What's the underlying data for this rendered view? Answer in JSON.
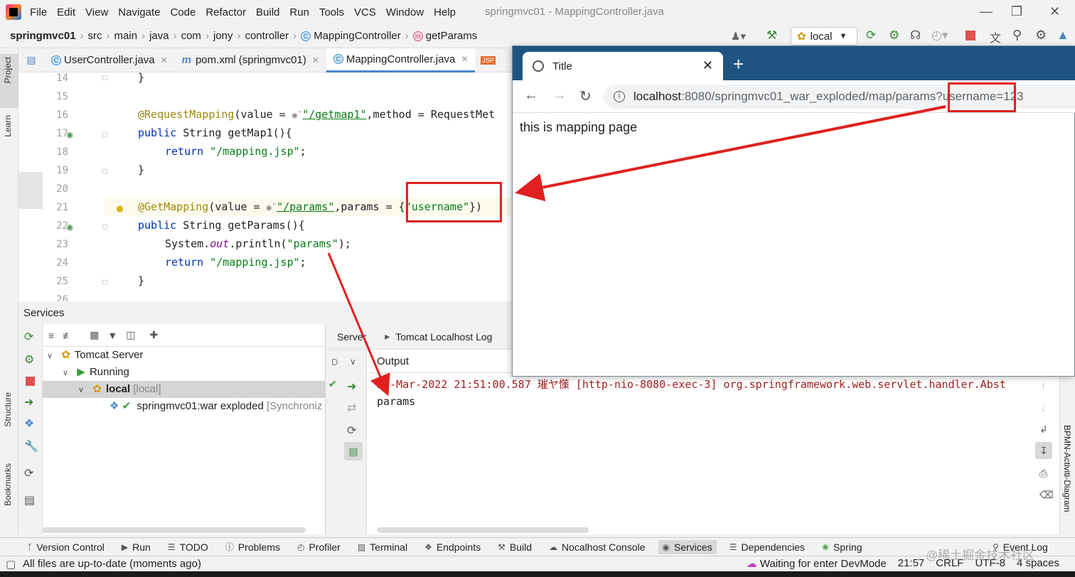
{
  "menubar": {
    "items": [
      "File",
      "Edit",
      "View",
      "Navigate",
      "Code",
      "Refactor",
      "Build",
      "Run",
      "Tools",
      "VCS",
      "Window",
      "Help"
    ],
    "window_title": "springmvc01 - MappingController.java"
  },
  "breadcrumb": {
    "project": "springmvc01",
    "parts": [
      "src",
      "main",
      "java",
      "com",
      "jony",
      "controller"
    ],
    "class": "MappingController",
    "method": "getParams"
  },
  "toolbar": {
    "run_config": "local"
  },
  "left_strip": {
    "project": "Project",
    "learn": "Learn",
    "structure": "Structure",
    "bookmarks": "Bookmarks"
  },
  "tabs": [
    {
      "label": "UserController.java"
    },
    {
      "label": "pom.xml (springmvc01)"
    },
    {
      "label": "MappingController.java"
    }
  ],
  "editor": {
    "line_numbers": [
      "14",
      "15",
      "16",
      "17",
      "18",
      "19",
      "20",
      "21",
      "22",
      "23",
      "24",
      "25",
      "26"
    ],
    "l14": "}",
    "l16_ann": "@RequestMapping",
    "l16_a": "(value = ",
    "l16_str": "\"/getmap1\"",
    "l16_b": ",method = RequestMet",
    "l17_kw": "public",
    "l17_rest": " String getMap1(){",
    "l18_kw": "return",
    "l18_str": " \"/mapping.jsp\"",
    "l18_end": ";",
    "l19": "}",
    "l21_ann": "@GetMapping",
    "l21_a": "(value = ",
    "l21_str": "\"/params\"",
    "l21_b": ",params = {",
    "l21_str2": "\"username\"",
    "l21_c": "})",
    "l22_kw": "public",
    "l22_rest": " String getParams(){",
    "l23_a": "System.",
    "l23_out": "out",
    "l23_b": ".println(",
    "l23_str": "\"params\"",
    "l23_c": ");",
    "l24_kw": "return",
    "l24_str": " \"/mapping.jsp\"",
    "l24_end": ";",
    "l25": "}"
  },
  "services": {
    "title": "Services",
    "tree": {
      "tomcat": "Tomcat Server",
      "running": "Running",
      "local": "local",
      "local_tag": "[local]",
      "artifact": "springmvc01:war exploded",
      "artifact_tag": "[Synchroniz"
    },
    "detail_tabs": [
      "Server",
      "Tomcat Localhost Log"
    ],
    "output_label": "Output",
    "col_label": "D",
    "log_line1": "21-Mar-2022 21:51:00.587 璀ヤ憡 [http-nio-8080-exec-3] org.springframework.web.servlet.handler.Abst",
    "log_line2": "params"
  },
  "right_strip": {
    "label": "BPMN-Activiti-Diagram"
  },
  "tool_windows": [
    "Version Control",
    "Run",
    "TODO",
    "Problems",
    "Profiler",
    "Terminal",
    "Endpoints",
    "Build",
    "Nocalhost Console",
    "Services",
    "Dependencies",
    "Spring",
    "Event Log"
  ],
  "status": {
    "left": "All files are up-to-date (moments ago)",
    "devmode": "Waiting for enter DevMode",
    "position": "21:57",
    "line_sep": "CRLF",
    "encoding": "UTF-8",
    "indent": "4 spaces",
    "watermark": "@稀土掘金技术社区"
  },
  "browser": {
    "tab_title": "Title",
    "url_host": "localhost",
    "url_rest": ":8080/springmvc01_war_exploded/map/params",
    "url_query": "?username",
    "url_value": "=123",
    "content": "this is mapping page"
  },
  "colors": {
    "annotation_red": "#e02020",
    "browser_bar": "#1f5481",
    "accent": "#4a88c7"
  }
}
